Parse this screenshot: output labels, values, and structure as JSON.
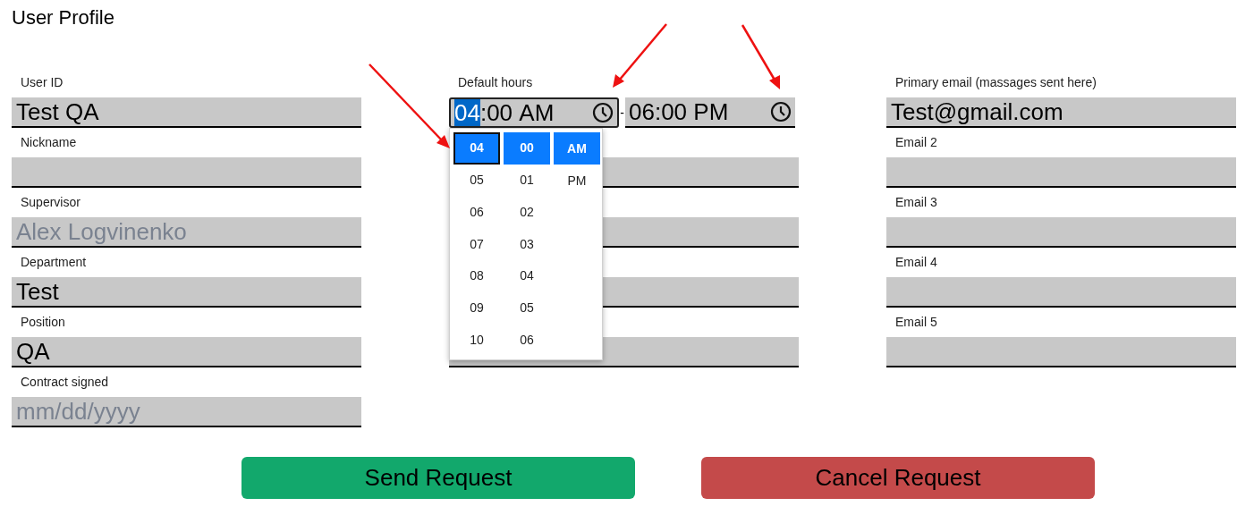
{
  "title": "User Profile",
  "left_fields": [
    {
      "label": "User ID",
      "value": "Test QA",
      "disabled": false
    },
    {
      "label": "Nickname"
    },
    {
      "label": "Supervisor",
      "value": "Alex Logvinenko",
      "disabled": true
    },
    {
      "label": "Department",
      "value": "Test",
      "disabled": false
    },
    {
      "label": "Position",
      "value": "QA",
      "disabled": false
    },
    {
      "label": "Contract signed",
      "placeholder": "mm/dd/yyyy"
    }
  ],
  "default_hours": {
    "label": "Default hours",
    "separator": "-",
    "times": [
      {
        "focused": true,
        "segments": [
          {
            "text": "04",
            "selected": true
          },
          {
            "text": ":00 AM",
            "selected": false
          }
        ]
      },
      {
        "focused": false,
        "segments": [
          {
            "text": "06:00 PM",
            "selected": false
          }
        ]
      }
    ],
    "picker": {
      "columns": [
        {
          "options": [
            {
              "text": "04",
              "selected": true,
              "focused": true
            },
            {
              "text": "05",
              "selected": false,
              "focused": false
            },
            {
              "text": "06",
              "selected": false,
              "focused": false
            },
            {
              "text": "07",
              "selected": false,
              "focused": false
            },
            {
              "text": "08",
              "selected": false,
              "focused": false
            },
            {
              "text": "09",
              "selected": false,
              "focused": false
            },
            {
              "text": "10",
              "selected": false,
              "focused": false
            }
          ]
        },
        {
          "options": [
            {
              "text": "00",
              "selected": true,
              "focused": false
            },
            {
              "text": "01",
              "selected": false,
              "focused": false
            },
            {
              "text": "02",
              "selected": false,
              "focused": false
            },
            {
              "text": "03",
              "selected": false,
              "focused": false
            },
            {
              "text": "04",
              "selected": false,
              "focused": false
            },
            {
              "text": "05",
              "selected": false,
              "focused": false
            },
            {
              "text": "06",
              "selected": false,
              "focused": false
            }
          ]
        },
        {
          "options": [
            {
              "text": "AM",
              "selected": true,
              "focused": false
            },
            {
              "text": "PM",
              "selected": false,
              "focused": false
            }
          ]
        }
      ]
    }
  },
  "middle_fields": [
    {
      "kind": "text"
    },
    {
      "kind": "text"
    },
    {
      "kind": "text"
    },
    {
      "kind": "text"
    }
  ],
  "right_fields": [
    {
      "label": "Primary email (massages sent here)",
      "value": "Test@gmail.com"
    },
    {
      "label": "Email 2"
    },
    {
      "label": "Email 3"
    },
    {
      "label": "Email 4"
    },
    {
      "label": "Email 5"
    }
  ],
  "buttons": [
    {
      "label": "Send Request",
      "color": "#12a86c"
    },
    {
      "label": "Cancel Request",
      "color": "#c44a4a"
    }
  ]
}
